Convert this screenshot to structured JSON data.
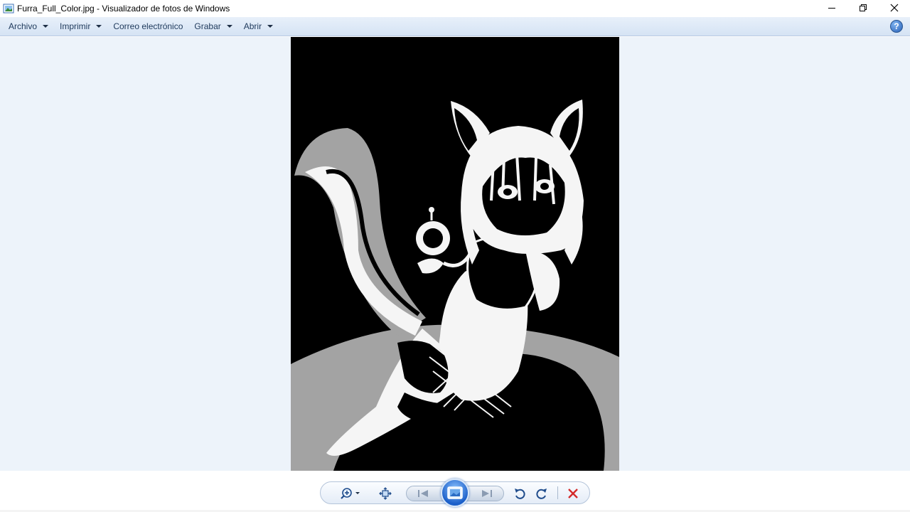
{
  "window": {
    "title": "Furra_Full_Color.jpg - Visualizador de fotos de Windows"
  },
  "menu": {
    "items": [
      {
        "label": "Archivo",
        "has_dropdown": true
      },
      {
        "label": "Imprimir",
        "has_dropdown": true
      },
      {
        "label": "Correo electrónico",
        "has_dropdown": false
      },
      {
        "label": "Grabar",
        "has_dropdown": true
      },
      {
        "label": "Abrir",
        "has_dropdown": true
      }
    ],
    "help_label": "?"
  },
  "toolbar": {
    "buttons": [
      {
        "name": "zoom",
        "icon": "magnifier-plus-icon"
      },
      {
        "name": "actual-size",
        "icon": "fit-window-icon"
      },
      {
        "name": "previous",
        "icon": "skip-back-icon"
      },
      {
        "name": "slideshow",
        "icon": "slideshow-icon"
      },
      {
        "name": "next",
        "icon": "skip-forward-icon"
      },
      {
        "name": "rotate-left",
        "icon": "rotate-ccw-icon"
      },
      {
        "name": "rotate-right",
        "icon": "rotate-cw-icon"
      },
      {
        "name": "delete",
        "icon": "delete-x-icon"
      }
    ]
  },
  "colors": {
    "viewer_background": "#edf3fa",
    "menu_text": "#1e395b",
    "delete_red": "#d42a2a",
    "photo_background": "#000000"
  }
}
